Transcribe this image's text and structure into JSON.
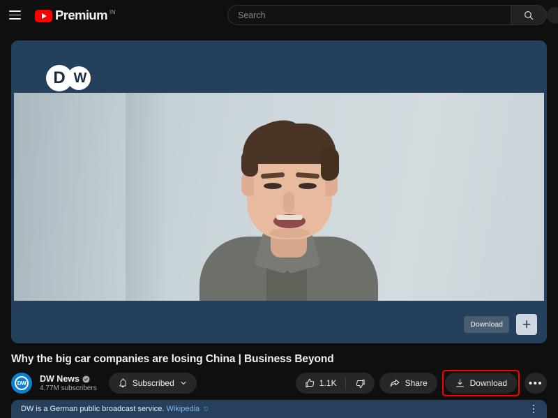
{
  "header": {
    "menu_icon": "hamburger-menu-icon",
    "logo_text": "Premium",
    "logo_superscript": "IN",
    "search_placeholder": "Search",
    "search_value": "",
    "search_icon": "search-icon"
  },
  "player": {
    "watermark_d": "D",
    "watermark_w": "W",
    "tooltip_label": "Download",
    "add_button_glyph": "+"
  },
  "video": {
    "title": "Why the big car companies are losing China | Business Beyond"
  },
  "channel": {
    "avatar_text": "DW",
    "name": "DW News",
    "verified_icon": "verified-badge-icon",
    "subscribers": "4.77M subscribers",
    "subscribe_label": "Subscribed",
    "bell_icon": "bell-icon",
    "chevron_icon": "chevron-down-icon"
  },
  "actions": {
    "like_icon": "thumbs-up-icon",
    "like_count": "1.1K",
    "dislike_icon": "thumbs-down-icon",
    "share_icon": "share-arrow-icon",
    "share_label": "Share",
    "download_icon": "download-arrow-icon",
    "download_label": "Download",
    "more_label": "•••",
    "highlight_color": "#ff0000"
  },
  "description": {
    "text": "DW is a German public broadcast service.",
    "link_label": "Wikipedia",
    "external_icon": "external-link-icon",
    "menu_icon": "kebab-menu-icon"
  },
  "colors": {
    "page_bg": "#0f0f0f",
    "player_bg": "#24405c",
    "description_bg": "#27405c",
    "accent_red": "#ff0000",
    "link_blue": "#7ab6f0"
  }
}
